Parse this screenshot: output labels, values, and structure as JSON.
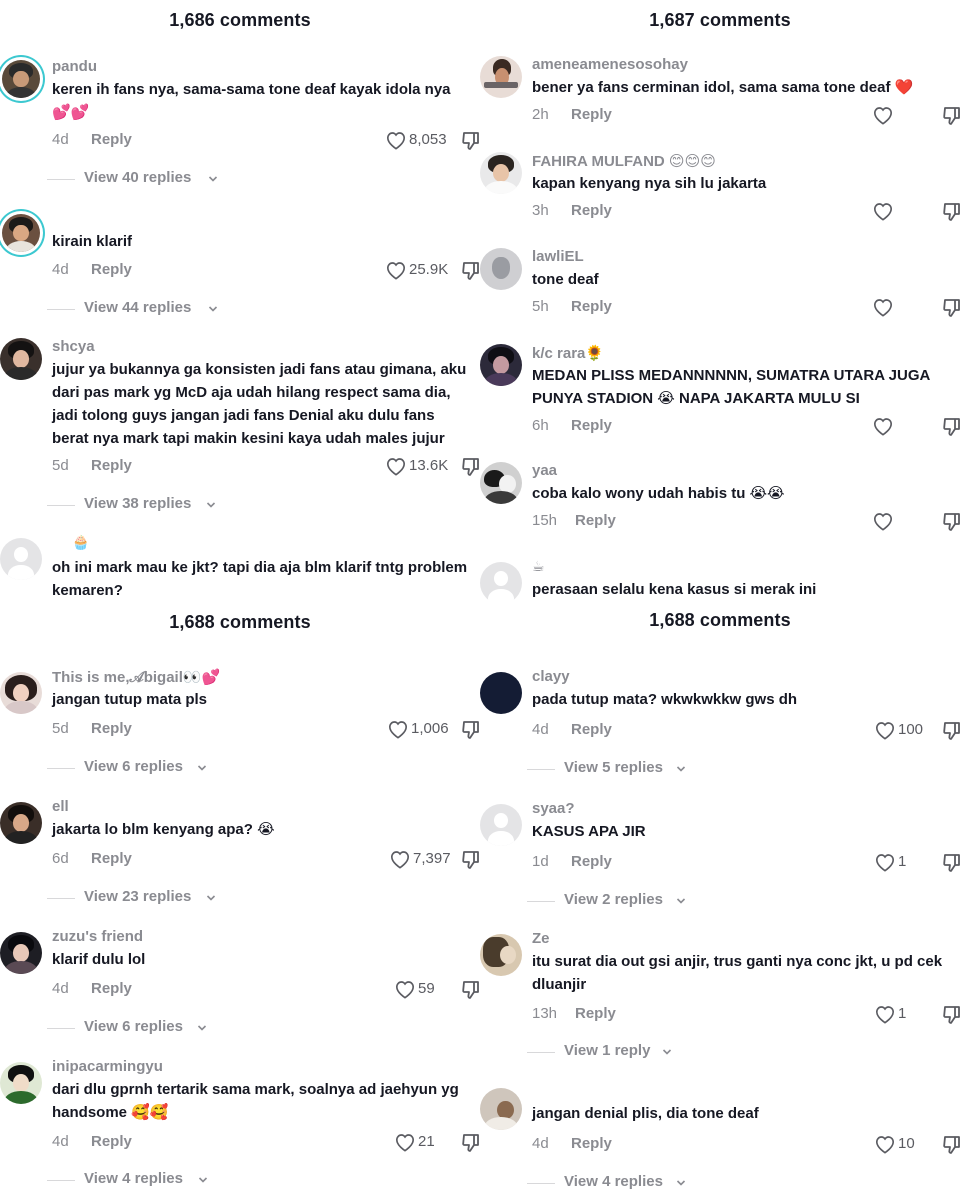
{
  "panels": [
    {
      "header": "1,686 comments",
      "comments": [
        {
          "user": "pandu",
          "text": "keren ih fans nya, sama-sama tone deaf kayak idola nya 💕💕",
          "age": "4d",
          "reply": "Reply",
          "likes": "8,053",
          "views": "View 40 replies"
        },
        {
          "user": "",
          "text": "kirain klarif",
          "age": "4d",
          "reply": "Reply",
          "likes": "25.9K",
          "views": "View 44 replies"
        },
        {
          "user": "shcya",
          "text": "jujur ya bukannya ga konsisten jadi fans atau gimana, aku dari pas mark yg McD aja udah hilang respect sama dia, jadi tolong guys jangan jadi fans Denial aku dulu fans berat nya mark tapi makin kesini kaya udah males jujur",
          "age": "5d",
          "reply": "Reply",
          "likes": "13.6K",
          "views": "View 38 replies"
        },
        {
          "user": "🧁",
          "text": "oh ini mark mau ke jkt? tapi dia aja blm klarif tntg problem kemaren?",
          "age": "",
          "reply": "",
          "likes": "",
          "views": ""
        }
      ]
    },
    {
      "header": "1,687 comments",
      "comments": [
        {
          "user": "ameneamenesosohay",
          "text": "bener ya fans cerminan idol, sama sama tone deaf ❤️",
          "age": "2h",
          "reply": "Reply",
          "likes": "",
          "views": ""
        },
        {
          "user": "FAHIRA MULFAND 😊😊😊",
          "text": "kapan kenyang nya sih lu jakarta",
          "age": "3h",
          "reply": "Reply",
          "likes": "",
          "views": ""
        },
        {
          "user": "lawliEL",
          "text": "tone deaf",
          "age": "5h",
          "reply": "Reply",
          "likes": "",
          "views": ""
        },
        {
          "user": "k/c rara🌻",
          "text": "MEDAN PLISS MEDANNNNNN, SUMATRA UTARA JUGA PUNYA STADION 😭 NAPA JAKARTA MULU SI",
          "age": "6h",
          "reply": "Reply",
          "likes": "",
          "views": ""
        },
        {
          "user": "yaa",
          "text": "coba kalo wony udah habis tu 😭😭",
          "age": "15h",
          "reply": "Reply",
          "likes": "",
          "views": ""
        },
        {
          "user": "☕",
          "text": "perasaan selalu kena kasus si merak ini",
          "age": "",
          "reply": "",
          "likes": "",
          "views": ""
        }
      ]
    },
    {
      "header": "1,688 comments",
      "comments": [
        {
          "user": "This is me,𝒜bigail👀💕",
          "text": "jangan tutup mata pls",
          "age": "5d",
          "reply": "Reply",
          "likes": "1,006",
          "views": "View 6 replies"
        },
        {
          "user": "ell",
          "text": "jakarta lo blm kenyang apa? 😭",
          "age": "6d",
          "reply": "Reply",
          "likes": "7,397",
          "views": "View 23 replies"
        },
        {
          "user": "zuzu's friend",
          "text": "klarif dulu lol",
          "age": "4d",
          "reply": "Reply",
          "likes": "59",
          "views": "View 6 replies"
        },
        {
          "user": "inipacarmingyu",
          "text": "dari dlu gprnh tertarik sama mark, soalnya ad jaehyun yg handsome 🥰🥰",
          "age": "4d",
          "reply": "Reply",
          "likes": "21",
          "views": "View 4 replies"
        }
      ]
    },
    {
      "header": "1,688 comments",
      "comments": [
        {
          "user": "clayy",
          "text": "pada tutup mata? wkwkwkkw gws dh",
          "age": "4d",
          "reply": "Reply",
          "likes": "100",
          "views": "View 5 replies"
        },
        {
          "user": "syaa?",
          "text": "KASUS APA JIR",
          "age": "1d",
          "reply": "Reply",
          "likes": "1",
          "views": "View 2 replies"
        },
        {
          "user": "Ze",
          "text": "itu surat dia out gsi anjir, trus ganti nya conc jkt, u pd cek dluanjir",
          "age": "13h",
          "reply": "Reply",
          "likes": "1",
          "views": "View 1 reply"
        },
        {
          "user": "",
          "text": "jangan denial plis, dia tone deaf",
          "age": "4d",
          "reply": "Reply",
          "likes": "10",
          "views": "View 4 replies"
        }
      ]
    }
  ],
  "colors": {
    "text": "#161823",
    "muted": "#8a8b91",
    "ring": "#3cc8d0",
    "heart": "#5a5b61"
  },
  "icons": {
    "like": "heart-outline-icon",
    "dislike": "thumbs-down-outline-icon",
    "expand": "chevron-down-icon"
  }
}
